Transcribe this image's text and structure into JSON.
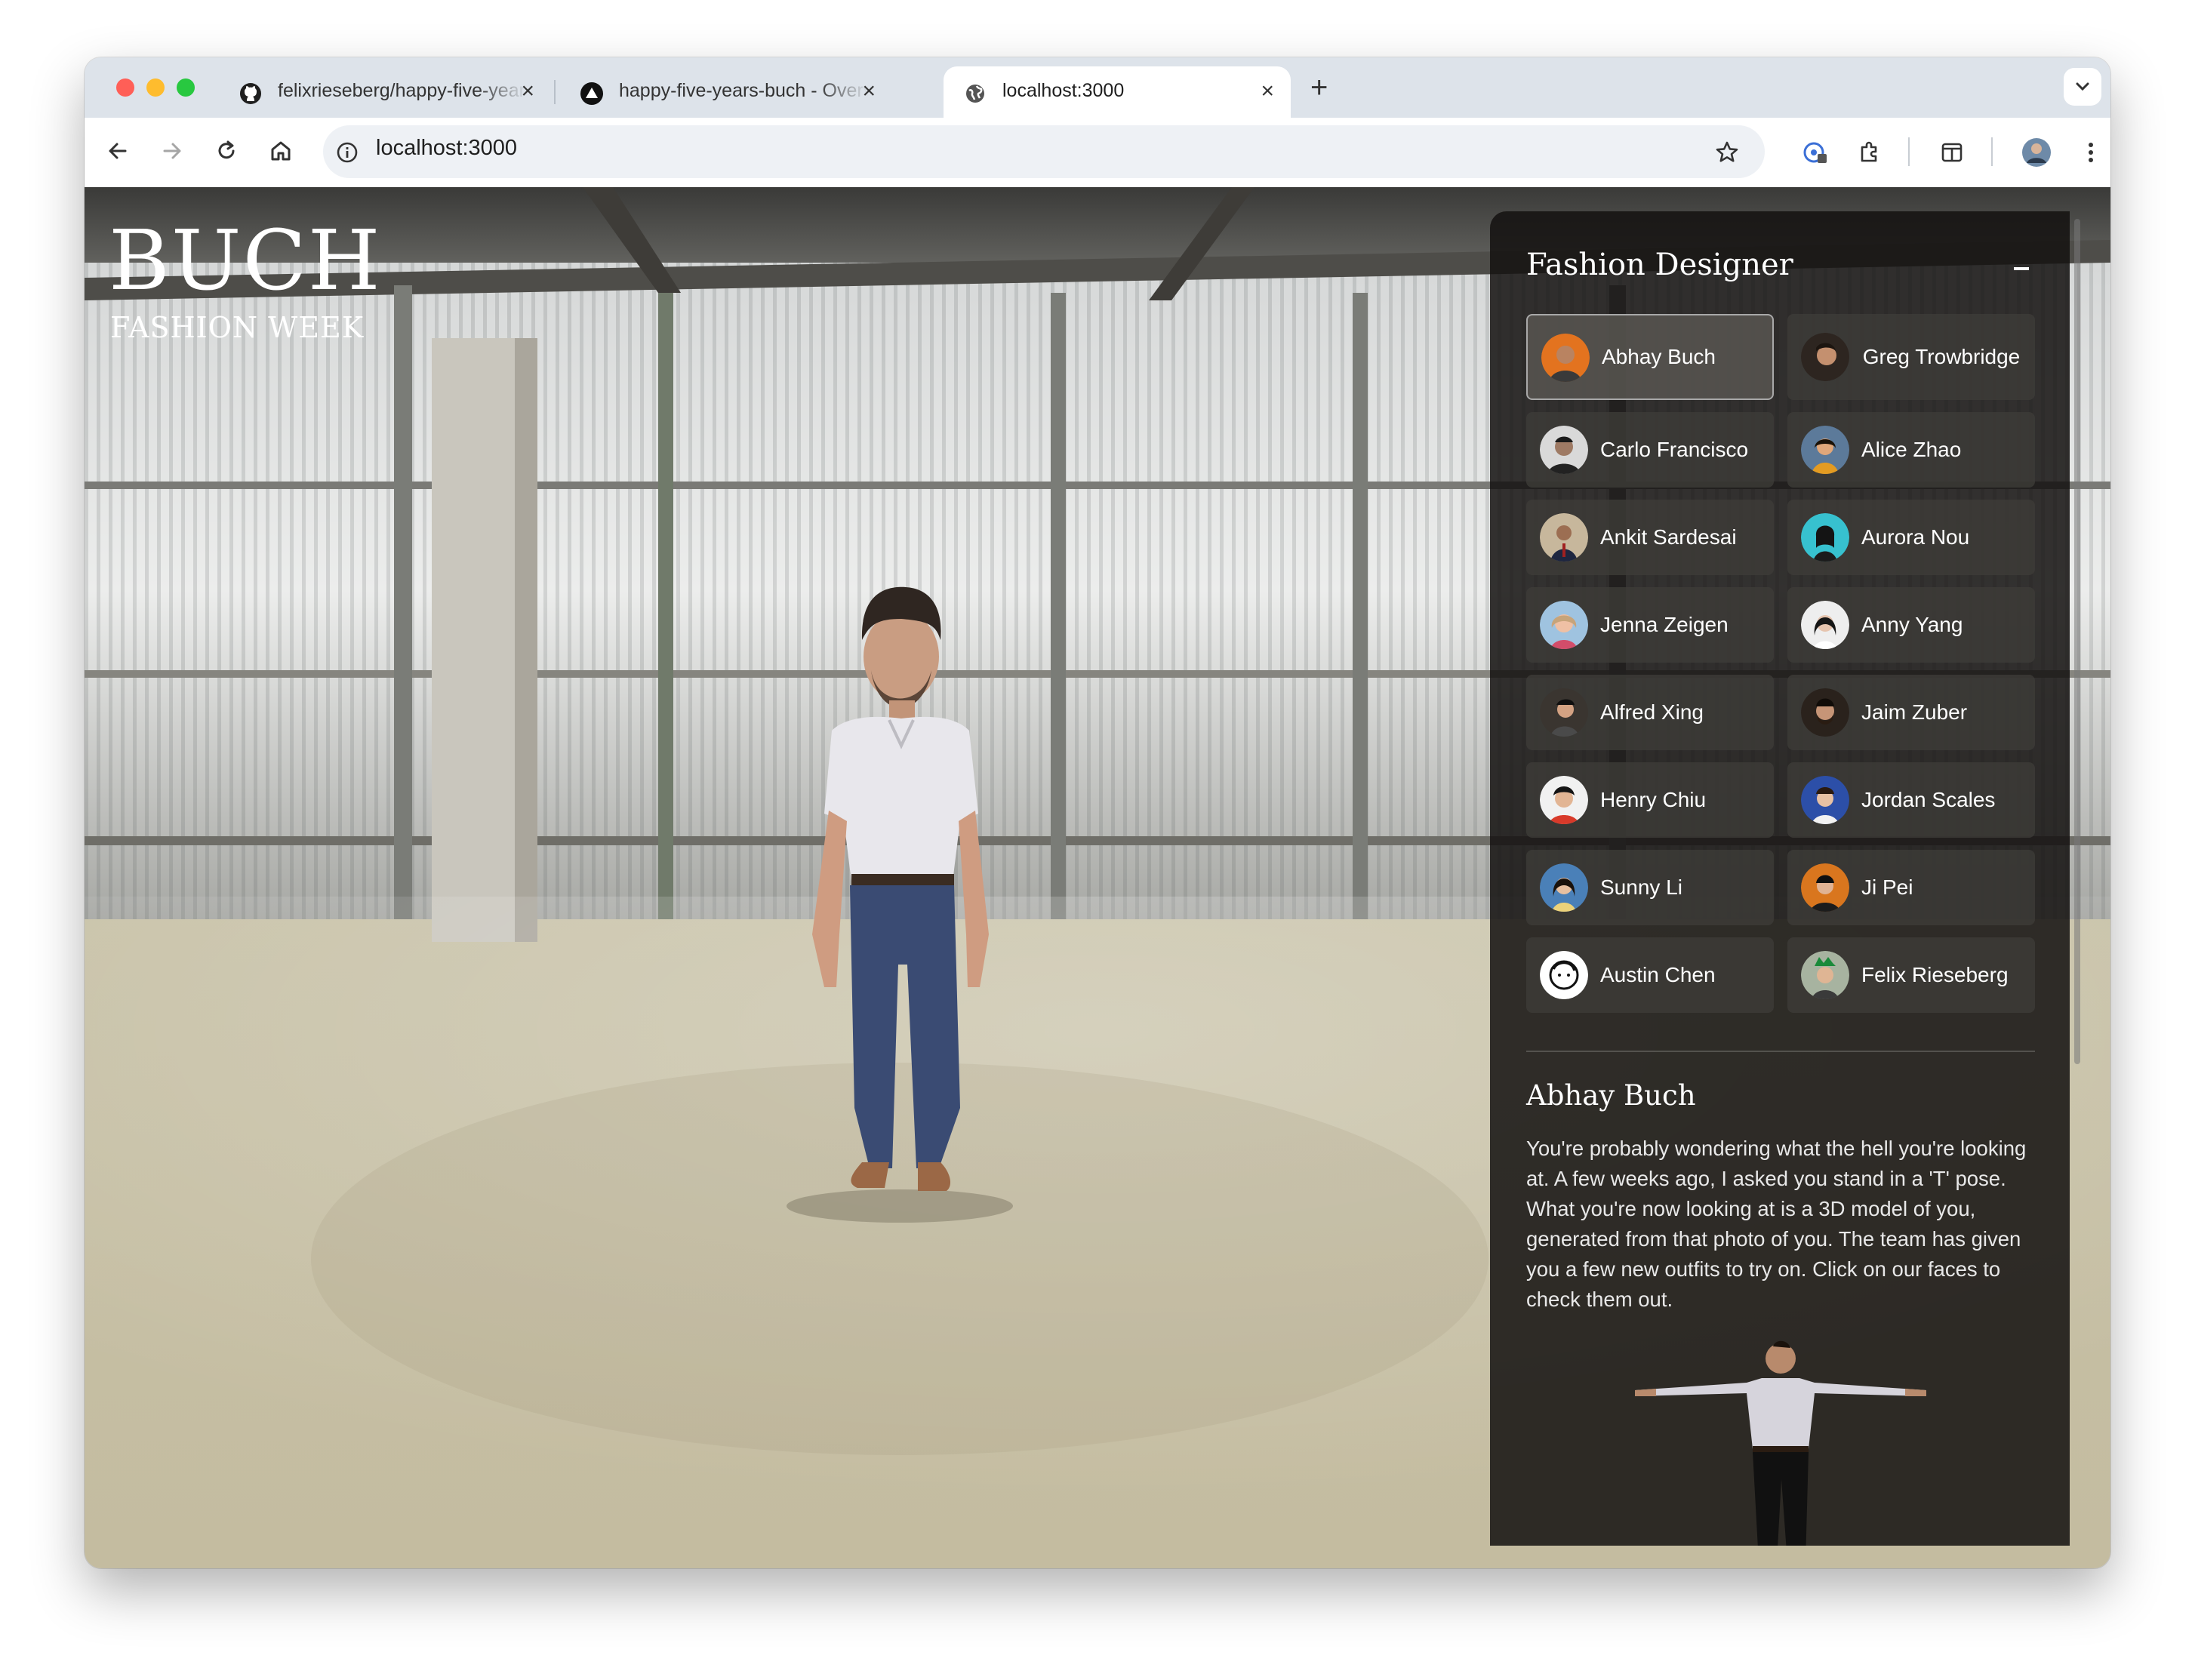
{
  "browser": {
    "tabs": [
      {
        "title": "felixrieseberg/happy-five-years-buch",
        "favicon": "github-icon",
        "active": false
      },
      {
        "title": "happy-five-years-buch - Overview",
        "favicon": "vercel-icon",
        "active": false
      },
      {
        "title": "localhost:3000",
        "favicon": "globe-icon",
        "active": true
      }
    ],
    "address": "localhost:3000"
  },
  "page": {
    "brand_title": "BUCH",
    "brand_subtitle": "FASHION WEEK",
    "panel_title": "Fashion Designer",
    "designers": [
      {
        "name": "Abhay Buch",
        "selected": true
      },
      {
        "name": "Greg Trowbridge",
        "selected": false
      },
      {
        "name": "Carlo Francisco",
        "selected": false
      },
      {
        "name": "Alice Zhao",
        "selected": false
      },
      {
        "name": "Ankit Sardesai",
        "selected": false
      },
      {
        "name": "Aurora Nou",
        "selected": false
      },
      {
        "name": "Jenna Zeigen",
        "selected": false
      },
      {
        "name": "Anny Yang",
        "selected": false
      },
      {
        "name": "Alfred Xing",
        "selected": false
      },
      {
        "name": "Jaim Zuber",
        "selected": false
      },
      {
        "name": "Henry Chiu",
        "selected": false
      },
      {
        "name": "Jordan Scales",
        "selected": false
      },
      {
        "name": "Sunny Li",
        "selected": false
      },
      {
        "name": "Ji Pei",
        "selected": false
      },
      {
        "name": "Austin Chen",
        "selected": false
      },
      {
        "name": "Felix Rieseberg",
        "selected": false
      }
    ],
    "detail": {
      "name": "Abhay Buch",
      "text": "You're probably wondering what the hell you're looking at. A few weeks ago, I asked you stand in a 'T' pose. What you're now looking at is a 3D model of you, generated from that photo of you. The team has given you a few new outfits to try on. Click on our faces to check them out."
    }
  },
  "colors": {
    "accent_red": "#ff5f57",
    "accent_yellow": "#febc2e",
    "accent_green": "#28c840",
    "panel_bg": "#141210",
    "card_bg": "#3e3c39"
  }
}
